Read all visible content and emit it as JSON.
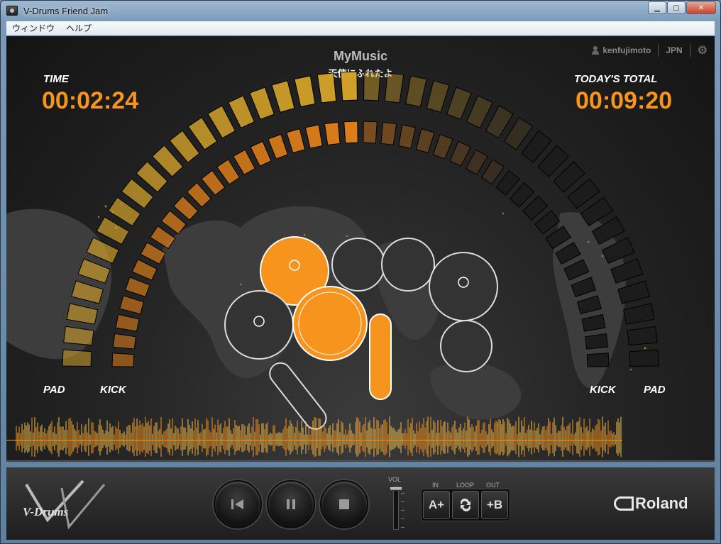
{
  "window": {
    "title": "V-Drums Friend Jam",
    "minimize_label": "▁",
    "maximize_label": "▢",
    "close_label": "✕"
  },
  "menu": {
    "items": [
      "ウィンドウ",
      "ヘルプ"
    ]
  },
  "user": {
    "name": "kenfujimoto",
    "language": "JPN"
  },
  "song": {
    "title": "MyMusic",
    "subtitle": "天使にふれたよ"
  },
  "time": {
    "label": "TIME",
    "value": "00:02:24"
  },
  "total": {
    "label": "TODAY'S TOTAL",
    "value": "00:09:20"
  },
  "meters": {
    "left_outer_label": "PAD",
    "left_inner_label": "KICK",
    "right_inner_label": "KICK",
    "right_outer_label": "PAD",
    "outer_segments": 40,
    "outer_lit_fraction": 0.5,
    "inner_segments": 40,
    "inner_lit_fraction": 0.5
  },
  "playback": {
    "progress_fraction": 0.89
  },
  "controls": {
    "prev_icon": "skip-back-icon",
    "pause_icon": "pause-icon",
    "stop_icon": "stop-icon",
    "vol_label": "VOL",
    "volume_fraction": 1.0,
    "loop_in_label": "IN",
    "loop_label": "LOOP",
    "loop_out_label": "OUT",
    "a_button": "A+",
    "b_button": "+B"
  },
  "brand": {
    "logo_text": "V-Drums",
    "maker": "Roland"
  },
  "colors": {
    "accent": "#f7941d",
    "gold": "#c99a2e",
    "segment_off": "#1c1c1c"
  }
}
